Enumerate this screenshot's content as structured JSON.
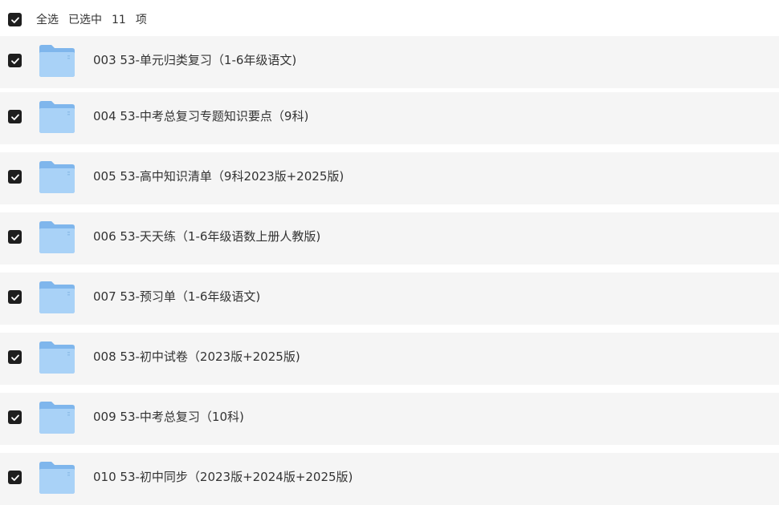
{
  "header": {
    "select_all_label": "全选",
    "selected_prefix": "已选中",
    "selected_count": "11",
    "selected_suffix": "项"
  },
  "items": [
    {
      "label": "003 53-单元归类复习（1-6年级语文)",
      "checked": true
    },
    {
      "label": "004 53-中考总复习专题知识要点（9科)",
      "checked": true
    },
    {
      "label": "005 53-高中知识清单（9科2023版+2025版)",
      "checked": true
    },
    {
      "label": "006 53-天天练（1-6年级语数上册人教版)",
      "checked": true
    },
    {
      "label": "007 53-预习单（1-6年级语文)",
      "checked": true
    },
    {
      "label": "008 53-初中试卷（2023版+2025版)",
      "checked": true
    },
    {
      "label": "009 53-中考总复习（10科)",
      "checked": true
    },
    {
      "label": "010 53-初中同步（2023版+2024版+2025版)",
      "checked": true
    }
  ],
  "colors": {
    "checkbox": "#1e1e1e",
    "row_background": "#f5f5f5",
    "folder_back": "#7fb6ec",
    "folder_front": "#a9d2f7"
  },
  "icons": {
    "checkbox": "check-icon",
    "folder": "folder-icon"
  }
}
